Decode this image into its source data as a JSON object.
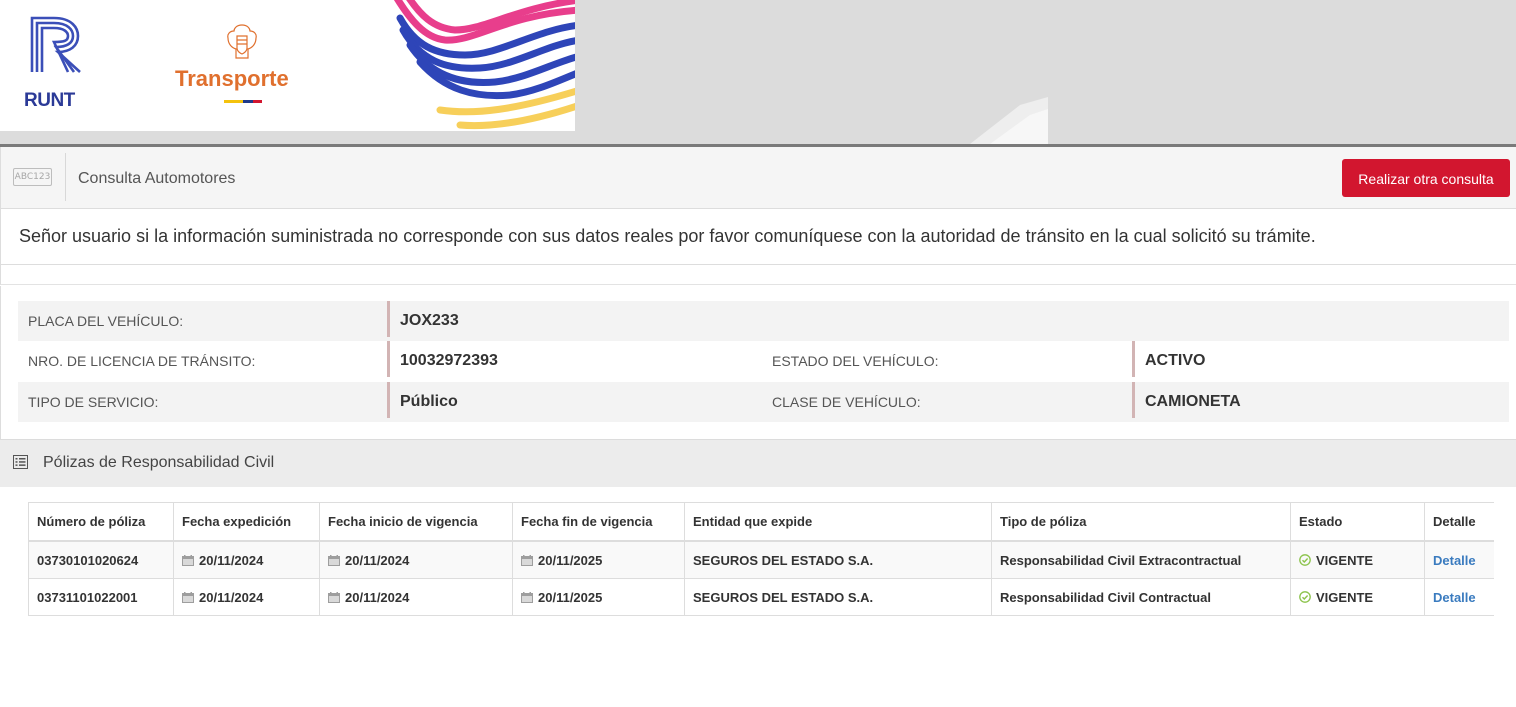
{
  "header": {
    "runt_logo_text": "RUNT",
    "ministry_text": "Transporte",
    "flag_colors": [
      "#f4c20d",
      "#1e3a8a",
      "#d2162f"
    ]
  },
  "toolbar": {
    "icon_text": "ABC123",
    "title": "Consulta Automotores",
    "button_label": "Realizar otra consulta"
  },
  "notice": {
    "text": "Señor usuario si la información suministrada no corresponde con sus datos reales por favor comuníquese con la autoridad de tránsito en la cual solicitó su trámite."
  },
  "vehicle": {
    "placa_label": "PLACA DEL VEHÍCULO:",
    "placa_value": "JOX233",
    "licencia_label": "NRO. DE LICENCIA DE TRÁNSITO:",
    "licencia_value": "10032972393",
    "estado_label": "ESTADO DEL VEHÍCULO:",
    "estado_value": "ACTIVO",
    "servicio_label": "TIPO DE SERVICIO:",
    "servicio_value": "Público",
    "clase_label": "CLASE DE VEHÍCULO:",
    "clase_value": "CAMIONETA"
  },
  "polizas": {
    "section_title": "Pólizas de Responsabilidad Civil",
    "columns": [
      "Número de póliza",
      "Fecha expedición",
      "Fecha inicio de vigencia",
      "Fecha fin de vigencia",
      "Entidad que expide",
      "Tipo de póliza",
      "Estado",
      "Detalle"
    ],
    "rows": [
      {
        "numero": "03730101020624",
        "expedicion": "20/11/2024",
        "inicio": "20/11/2024",
        "fin": "20/11/2025",
        "entidad": "SEGUROS DEL ESTADO S.A.",
        "tipo": "Responsabilidad Civil Extracontractual",
        "estado": "VIGENTE",
        "detalle": "Detalle"
      },
      {
        "numero": "03731101022001",
        "expedicion": "20/11/2024",
        "inicio": "20/11/2024",
        "fin": "20/11/2025",
        "entidad": "SEGUROS DEL ESTADO S.A.",
        "tipo": "Responsabilidad Civil Contractual",
        "estado": "VIGENTE",
        "detalle": "Detalle"
      }
    ]
  }
}
